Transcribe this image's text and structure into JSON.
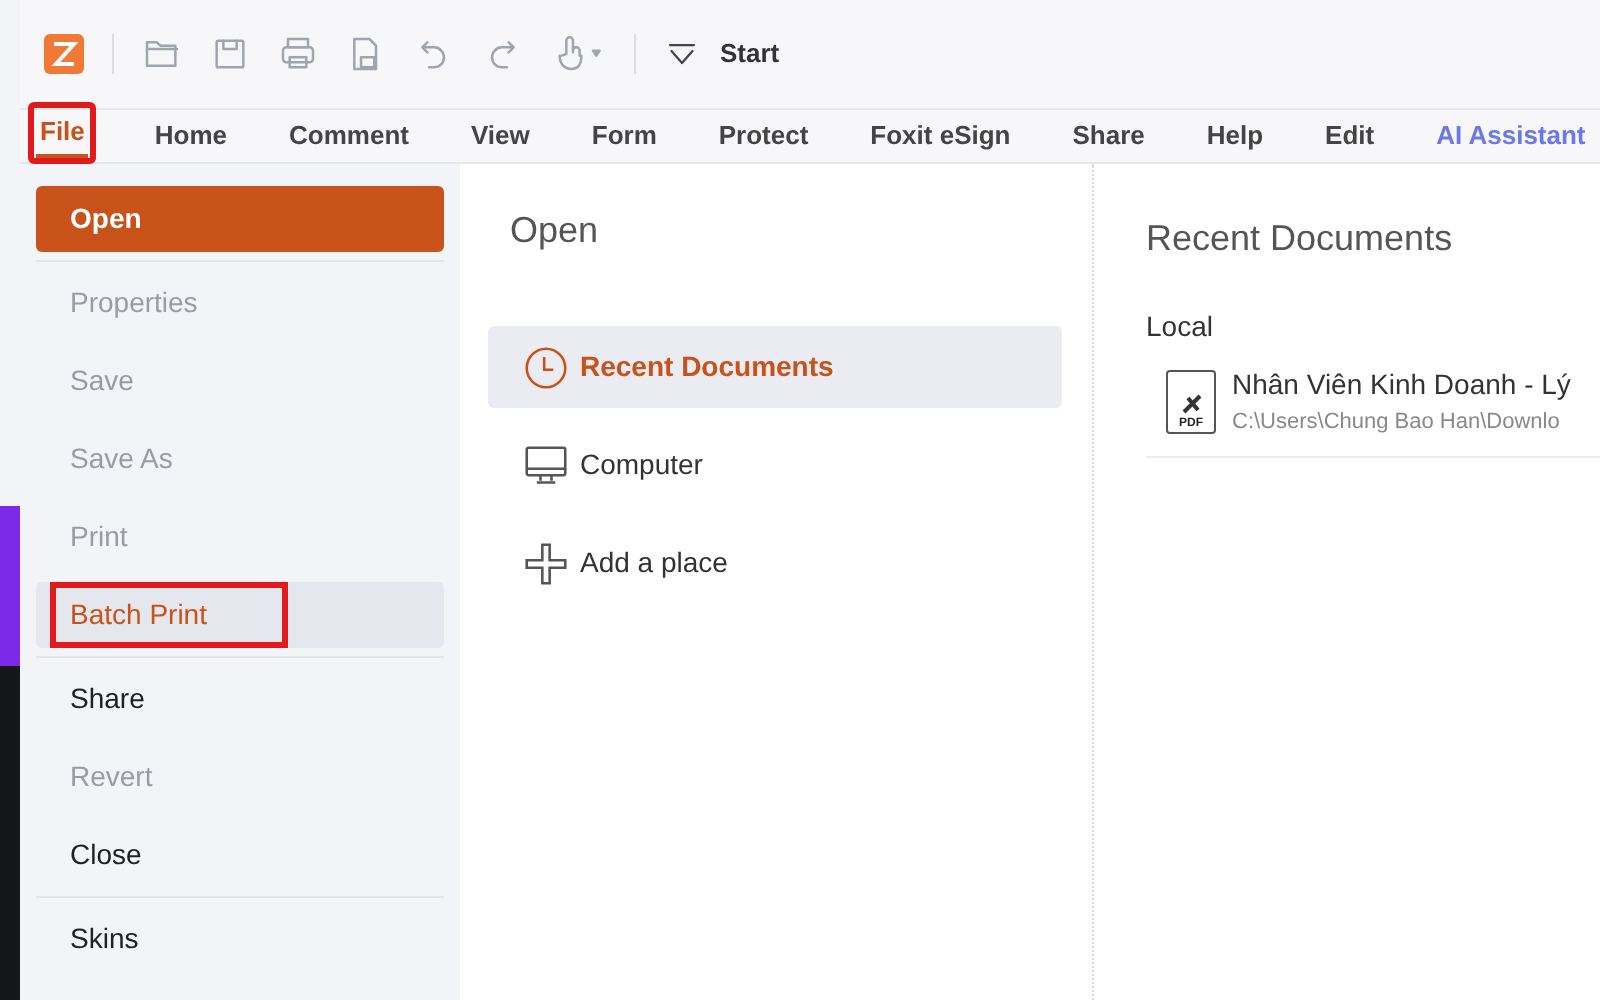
{
  "toolbar": {
    "start_label": "Start"
  },
  "menu_tabs": [
    {
      "label": "File",
      "selected": true,
      "highlighted": true,
      "kind": "normal"
    },
    {
      "label": "Home",
      "selected": false,
      "highlighted": false,
      "kind": "normal"
    },
    {
      "label": "Comment",
      "selected": false,
      "highlighted": false,
      "kind": "normal"
    },
    {
      "label": "View",
      "selected": false,
      "highlighted": false,
      "kind": "normal"
    },
    {
      "label": "Form",
      "selected": false,
      "highlighted": false,
      "kind": "normal"
    },
    {
      "label": "Protect",
      "selected": false,
      "highlighted": false,
      "kind": "normal"
    },
    {
      "label": "Foxit eSign",
      "selected": false,
      "highlighted": false,
      "kind": "normal"
    },
    {
      "label": "Share",
      "selected": false,
      "highlighted": false,
      "kind": "normal"
    },
    {
      "label": "Help",
      "selected": false,
      "highlighted": false,
      "kind": "normal"
    },
    {
      "label": "Edit",
      "selected": false,
      "highlighted": false,
      "kind": "normal"
    },
    {
      "label": "AI Assistant",
      "selected": false,
      "highlighted": false,
      "kind": "ai"
    }
  ],
  "file_menu": [
    {
      "label": "Open",
      "selected": true,
      "hovered": false,
      "disabled": false,
      "highlighted": false,
      "divider_after": true
    },
    {
      "label": "Properties",
      "selected": false,
      "hovered": false,
      "disabled": true,
      "highlighted": false,
      "divider_after": false
    },
    {
      "label": "Save",
      "selected": false,
      "hovered": false,
      "disabled": true,
      "highlighted": false,
      "divider_after": false
    },
    {
      "label": "Save As",
      "selected": false,
      "hovered": false,
      "disabled": true,
      "highlighted": false,
      "divider_after": false
    },
    {
      "label": "Print",
      "selected": false,
      "hovered": false,
      "disabled": true,
      "highlighted": false,
      "divider_after": false
    },
    {
      "label": "Batch Print",
      "selected": false,
      "hovered": true,
      "disabled": false,
      "highlighted": true,
      "divider_after": true
    },
    {
      "label": "Share",
      "selected": false,
      "hovered": false,
      "disabled": false,
      "highlighted": false,
      "divider_after": false
    },
    {
      "label": "Revert",
      "selected": false,
      "hovered": false,
      "disabled": true,
      "highlighted": false,
      "divider_after": false
    },
    {
      "label": "Close",
      "selected": false,
      "hovered": false,
      "disabled": false,
      "highlighted": false,
      "divider_after": true
    },
    {
      "label": "Skins",
      "selected": false,
      "hovered": false,
      "disabled": false,
      "highlighted": false,
      "divider_after": false
    }
  ],
  "open_panel": {
    "title": "Open",
    "places": [
      {
        "label": "Recent Documents",
        "kind": "recent",
        "selected": true
      },
      {
        "label": "Computer",
        "kind": "computer",
        "selected": false
      },
      {
        "label": "Add a place",
        "kind": "add",
        "selected": false
      }
    ]
  },
  "recent_panel": {
    "title": "Recent Documents",
    "section": "Local",
    "documents": [
      {
        "name": "Nhân Viên Kinh Doanh - Lý",
        "path": "C:\\Users\\Chung Bao Han\\Downlo",
        "icon_label": "PDF"
      }
    ]
  }
}
